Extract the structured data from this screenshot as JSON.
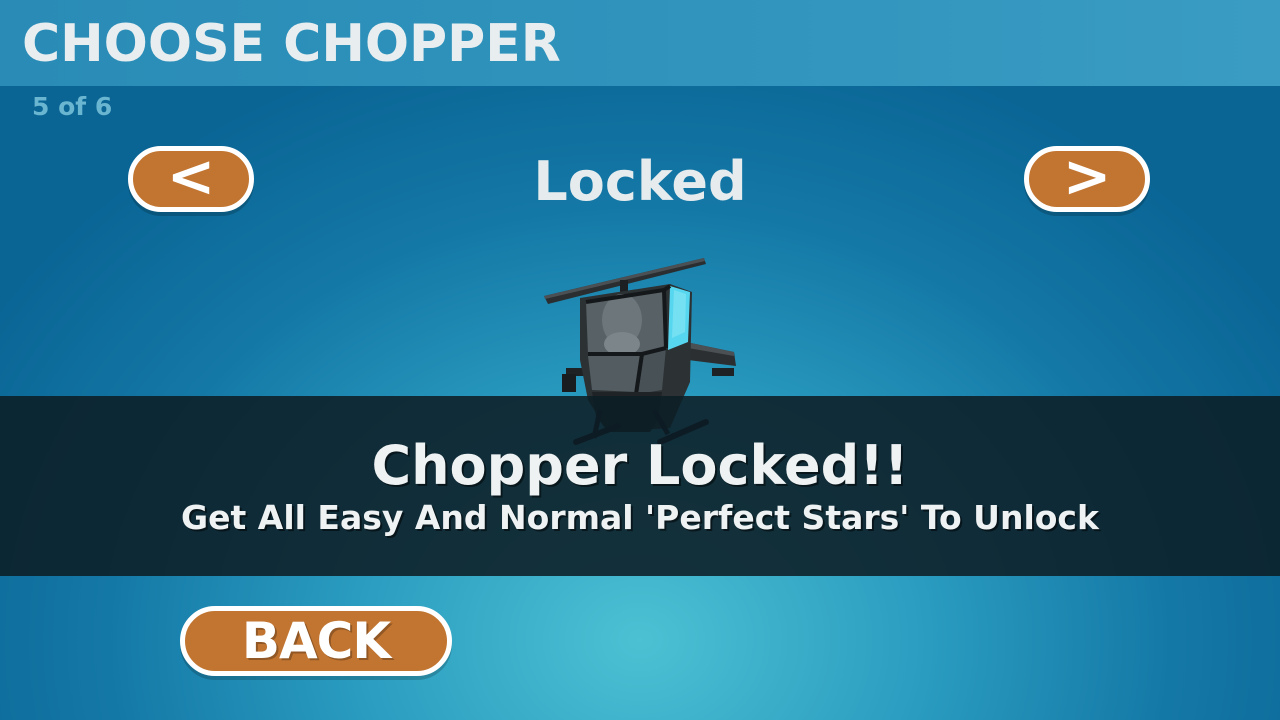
{
  "header": {
    "title": "CHOOSE CHOPPER",
    "counter": "5 of 6"
  },
  "selector": {
    "prev_label": "<",
    "next_label": ">",
    "status": "Locked",
    "chopper_icon": "helicopter-icon"
  },
  "lock_banner": {
    "title": "Chopper Locked!!",
    "message": "Get All Easy And Normal 'Perfect Stars' To Unlock"
  },
  "footer": {
    "back_label": "BACK"
  },
  "colors": {
    "button": "#c27531",
    "button_border": "#ffffff",
    "header": "#2f93bc",
    "banner": "#0c1e26"
  }
}
